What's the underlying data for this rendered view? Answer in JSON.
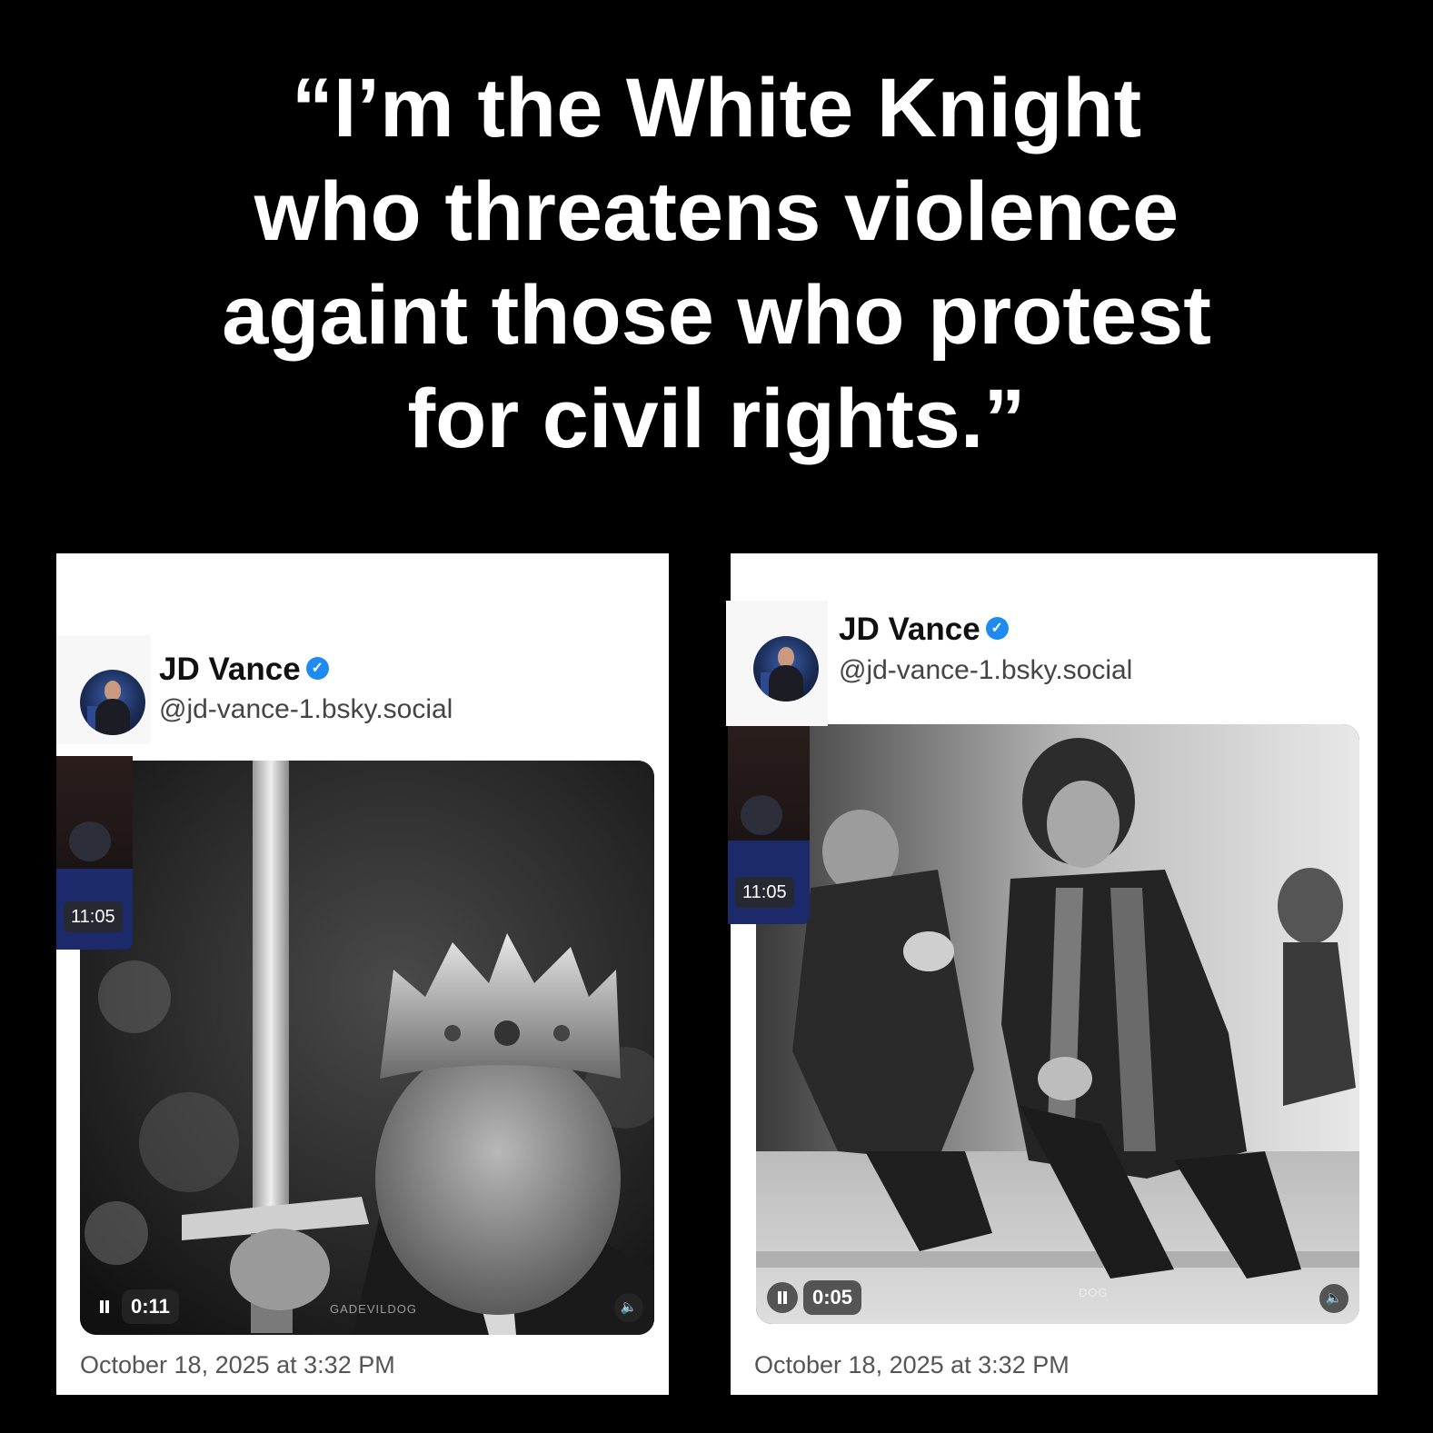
{
  "headline": {
    "line1": "“I’m the White Knight",
    "line2": "who threatens violence",
    "line3": "againt those who protest",
    "line4": "for civil rights.”"
  },
  "posts": [
    {
      "author_name": "JD Vance",
      "author_handle": "@jd-vance-1.bsky.social",
      "verified_icon": "check-icon",
      "video_time": "0:11",
      "watermark": "GADEVILDOG",
      "overlay_time": "11:05",
      "timestamp": "October 18, 2025 at 3:32 PM"
    },
    {
      "author_name": "JD Vance",
      "author_handle": "@jd-vance-1.bsky.social",
      "verified_icon": "check-icon",
      "video_time": "0:05",
      "watermark": "DOG",
      "overlay_time": "11:05",
      "timestamp": "October 18, 2025 at 3:32 PM"
    }
  ],
  "colors": {
    "background": "#000000",
    "card": "#ffffff",
    "verified": "#1d8bf0"
  }
}
